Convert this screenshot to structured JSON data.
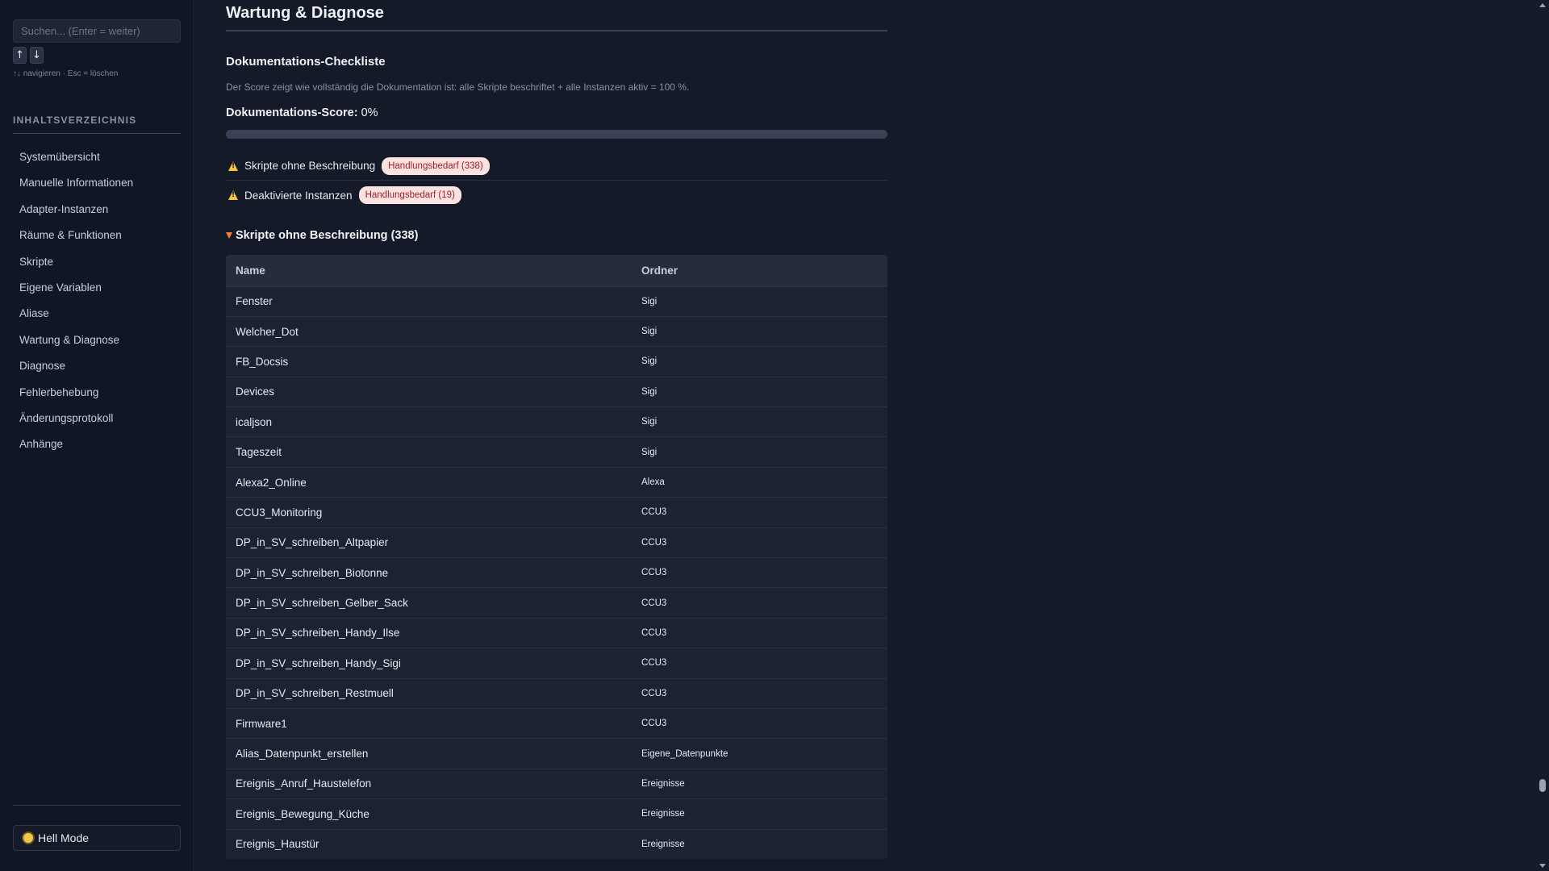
{
  "sidebar": {
    "search": {
      "placeholder": "Suchen... (Enter = weiter)",
      "up_label": "↑",
      "down_label": "↓",
      "hint": "↑↓ navigieren · Esc = löschen"
    },
    "toc_title": "INHALTSVERZEICHNIS",
    "items": [
      {
        "label": "Systemübersicht"
      },
      {
        "label": "Manuelle Informationen"
      },
      {
        "label": "Adapter-Instanzen"
      },
      {
        "label": "Räume & Funktionen"
      },
      {
        "label": "Skripte"
      },
      {
        "label": "Eigene Variablen"
      },
      {
        "label": "Aliase"
      },
      {
        "label": "Wartung & Diagnose"
      },
      {
        "label": "Diagnose"
      },
      {
        "label": "Fehlerbehebung"
      },
      {
        "label": "Änderungsprotokoll"
      },
      {
        "label": "Anhänge"
      }
    ],
    "theme_toggle": {
      "label": "Hell Mode",
      "icon": "sun-icon"
    }
  },
  "main": {
    "page_title": "Wartung & Diagnose",
    "section_title": "Dokumentations-Checkliste",
    "description": "Der Score zeigt wie vollständig die Dokumentation ist: alle Skripte beschriftet + alle Instanzen aktiv = 100 %.",
    "score": {
      "label": "Dokumentations-Score:",
      "value": "0%",
      "progress_percent": 0
    },
    "checklist": [
      {
        "icon": "warning-icon",
        "label": "Skripte ohne Beschreibung",
        "badge": "Handlungsbedarf (338)"
      },
      {
        "icon": "warning-icon",
        "label": "Deaktivierte Instanzen",
        "badge": "Handlungsbedarf (19)"
      }
    ],
    "details": {
      "summary": "Skripte ohne Beschreibung (338)",
      "expanded": true
    },
    "table": {
      "columns": [
        "Name",
        "Ordner"
      ],
      "rows": [
        {
          "name": "Fenster",
          "folder": "Sigi"
        },
        {
          "name": "Welcher_Dot",
          "folder": "Sigi"
        },
        {
          "name": "FB_Docsis",
          "folder": "Sigi"
        },
        {
          "name": "Devices",
          "folder": "Sigi"
        },
        {
          "name": "icaljson",
          "folder": "Sigi"
        },
        {
          "name": "Tageszeit",
          "folder": "Sigi"
        },
        {
          "name": "Alexa2_Online",
          "folder": "Alexa"
        },
        {
          "name": "CCU3_Monitoring",
          "folder": "CCU3"
        },
        {
          "name": "DP_in_SV_schreiben_Altpapier",
          "folder": "CCU3"
        },
        {
          "name": "DP_in_SV_schreiben_Biotonne",
          "folder": "CCU3"
        },
        {
          "name": "DP_in_SV_schreiben_Gelber_Sack",
          "folder": "CCU3"
        },
        {
          "name": "DP_in_SV_schreiben_Handy_Ilse",
          "folder": "CCU3"
        },
        {
          "name": "DP_in_SV_schreiben_Handy_Sigi",
          "folder": "CCU3"
        },
        {
          "name": "DP_in_SV_schreiben_Restmuell",
          "folder": "CCU3"
        },
        {
          "name": "Firmware1",
          "folder": "CCU3"
        },
        {
          "name": "Alias_Datenpunkt_erstellen",
          "folder": "Eigene_Datenpunkte"
        },
        {
          "name": "Ereignis_Anruf_Haustelefon",
          "folder": "Ereignisse"
        },
        {
          "name": "Ereignis_Bewegung_Küche",
          "folder": "Ereignisse"
        },
        {
          "name": "Ereignis_Haustür",
          "folder": "Ereignisse"
        }
      ]
    }
  },
  "colors": {
    "background": "#151a28",
    "sidebar": "#111624",
    "badge_bg": "#fde2e2",
    "badge_text": "#a01e2a",
    "warning": "#f4c542",
    "caret": "#ff7a3d"
  }
}
